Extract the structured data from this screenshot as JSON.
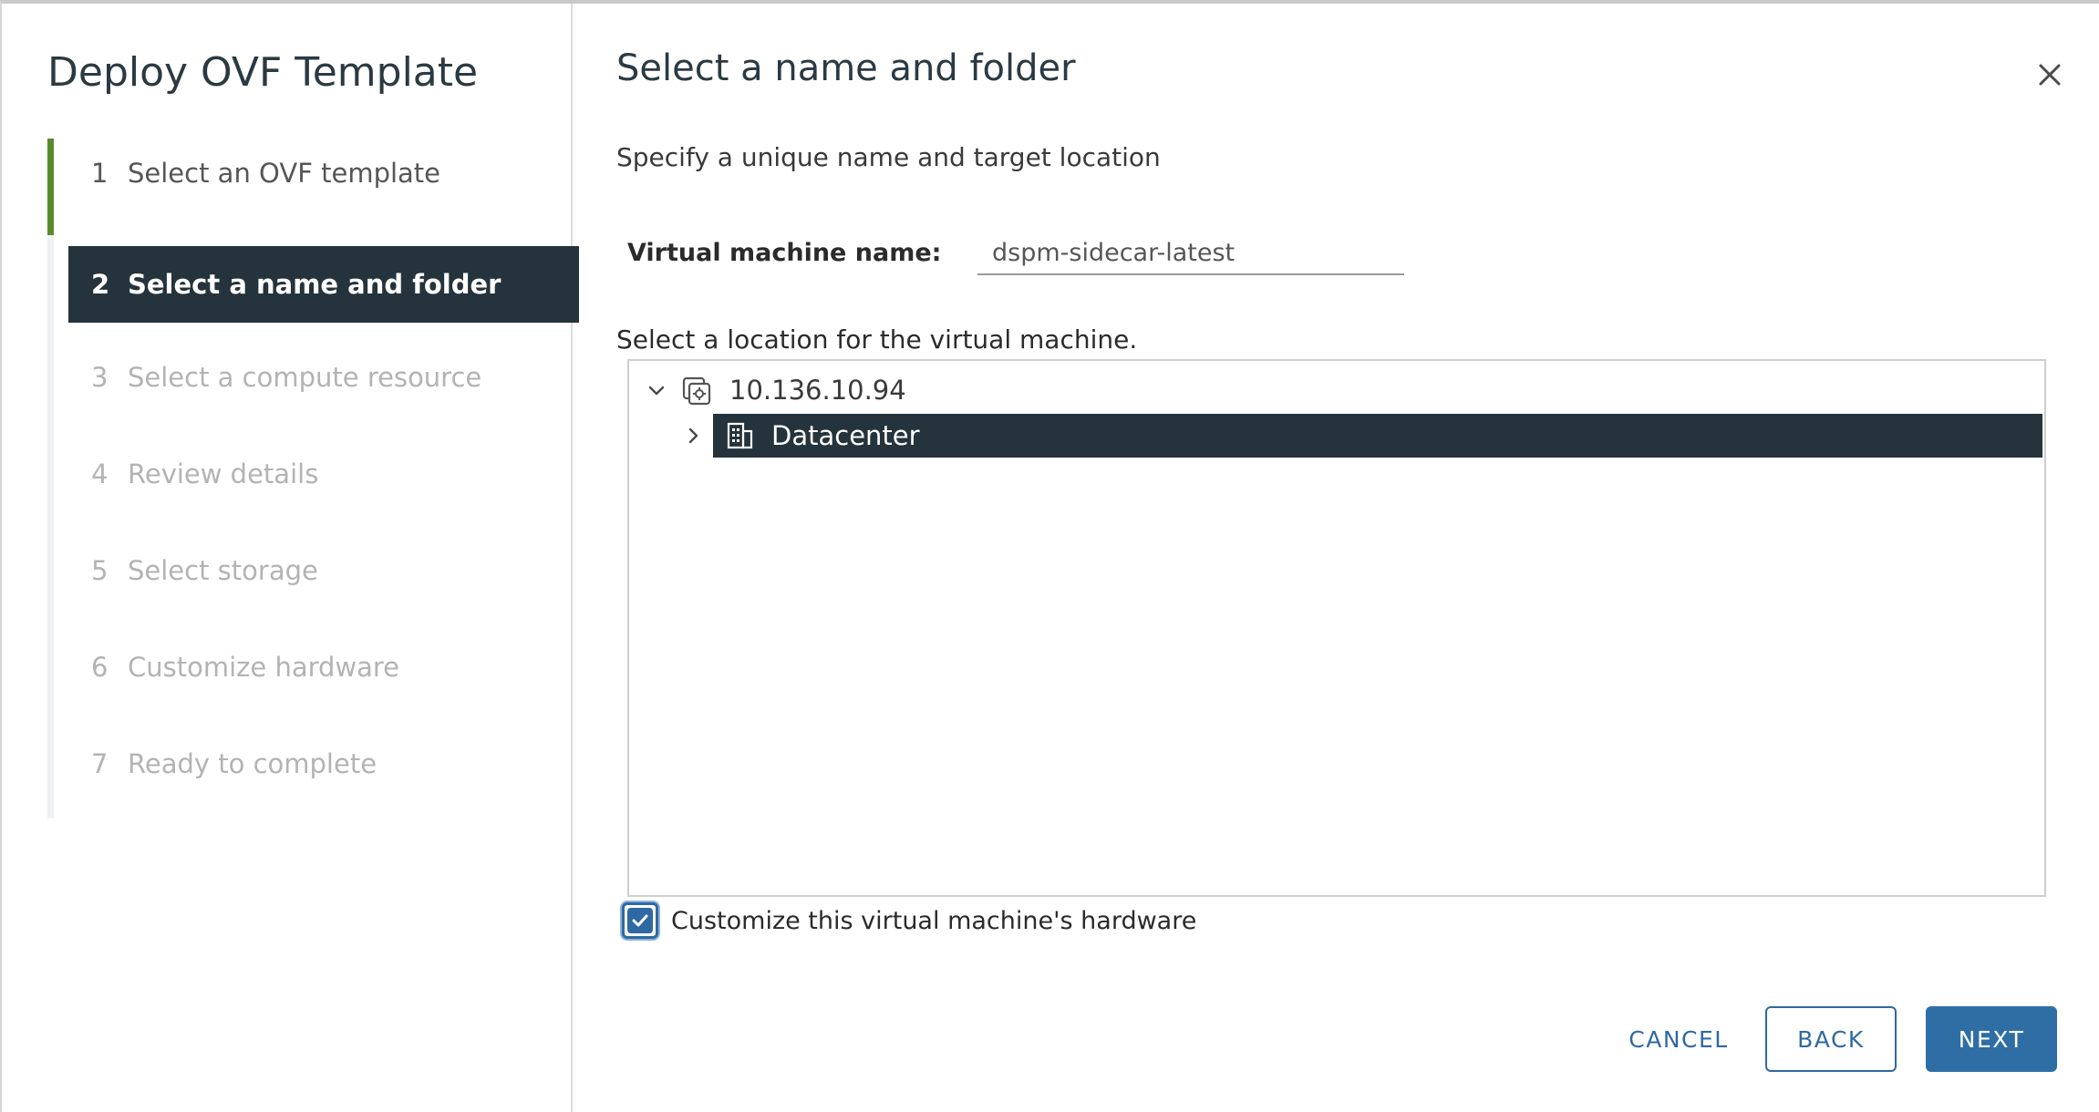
{
  "wizard": {
    "title": "Deploy OVF Template",
    "steps": [
      {
        "num": "1",
        "label": "Select an OVF template",
        "state": "done"
      },
      {
        "num": "2",
        "label": "Select a name and folder",
        "state": "active"
      },
      {
        "num": "3",
        "label": "Select a compute resource",
        "state": "pending"
      },
      {
        "num": "4",
        "label": "Review details",
        "state": "pending"
      },
      {
        "num": "5",
        "label": "Select storage",
        "state": "pending"
      },
      {
        "num": "6",
        "label": "Customize hardware",
        "state": "pending"
      },
      {
        "num": "7",
        "label": "Ready to complete",
        "state": "pending"
      }
    ]
  },
  "page": {
    "title": "Select a name and folder",
    "subtitle": "Specify a unique name and target location"
  },
  "form": {
    "vm_name_label": "Virtual machine name:",
    "vm_name_value": "dspm-sidecar-latest",
    "location_label": "Select a location for the virtual machine."
  },
  "tree": {
    "root": {
      "label": "10.136.10.94",
      "icon": "vcenter-icon",
      "expanded": true
    },
    "child": {
      "label": "Datacenter",
      "icon": "datacenter-icon",
      "selected": true,
      "expanded": false
    }
  },
  "customize_hardware": {
    "label": "Customize this virtual machine's hardware",
    "checked": true
  },
  "buttons": {
    "cancel": "CANCEL",
    "back": "BACK",
    "next": "NEXT"
  },
  "colors": {
    "accent": "#2f69a3",
    "selected_bg": "#25333c",
    "progress": "#5a8a2e"
  }
}
